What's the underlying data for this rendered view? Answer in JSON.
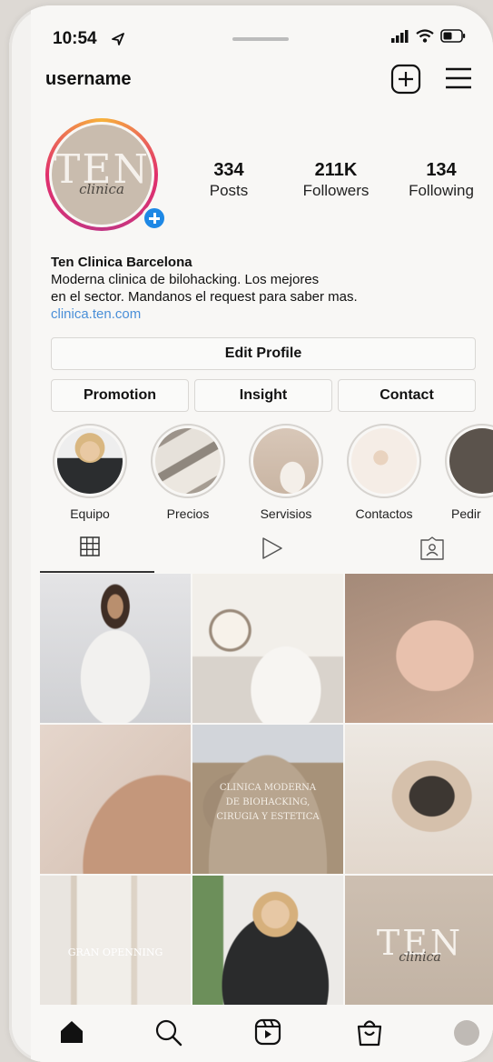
{
  "status": {
    "time": "10:54"
  },
  "header": {
    "username": "username"
  },
  "profile": {
    "avatar_text_main": "TEN",
    "avatar_text_script": "clinica",
    "stats": [
      {
        "value": "334",
        "label": "Posts"
      },
      {
        "value": "211K",
        "label": "Followers"
      },
      {
        "value": "134",
        "label": "Following"
      }
    ]
  },
  "bio": {
    "name": "Ten Clinica Barcelona",
    "line1": "Moderna clinica de bilohacking. Los mejores",
    "line2": "en el sector. Mandanos el request para saber mas.",
    "link": "clinica.ten.com"
  },
  "buttons": {
    "edit_profile": "Edit Profile",
    "promotion": "Promotion",
    "insight": "Insight",
    "contact": "Contact"
  },
  "highlights": [
    {
      "label": "Equipo"
    },
    {
      "label": "Precios"
    },
    {
      "label": "Servisios"
    },
    {
      "label": "Contactos"
    },
    {
      "label": "Pedir"
    }
  ],
  "posts": {
    "overlay_5": "CLINICA MODERNA DE BIOHACKING, CIRUGIA Y ESTETICA",
    "overlay_7": "GRAN OPENNING",
    "overlay_9_main": "TEN",
    "overlay_9_script": "clinica"
  },
  "colors": {
    "accent_blue": "#1e88e5",
    "link_blue": "#4a8fd8",
    "story_ring": "#e1306c"
  },
  "icons": {
    "tab_grid": "grid-icon",
    "tab_reels": "play-icon",
    "tab_tagged": "tagged-icon",
    "nav": [
      "home-icon",
      "search-icon",
      "reels-icon",
      "shop-icon",
      "profile-icon"
    ]
  }
}
